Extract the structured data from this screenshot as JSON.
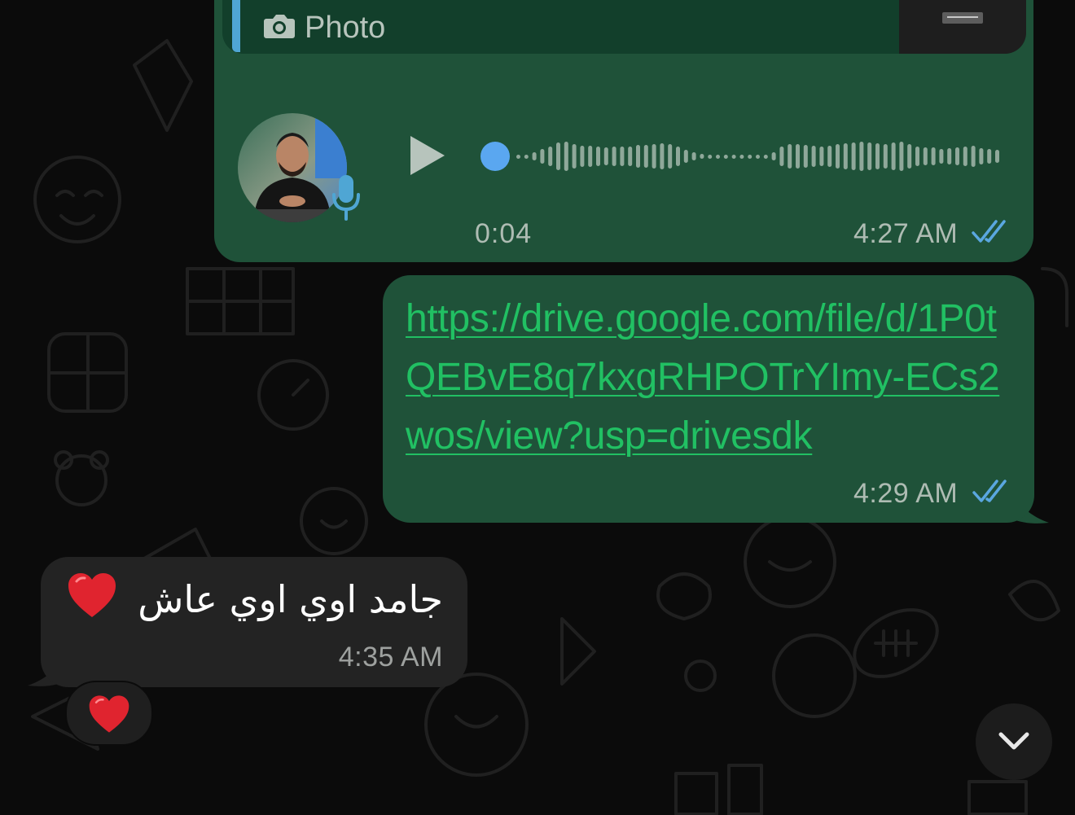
{
  "quoted_message": {
    "label": "Photo",
    "icon": "camera-icon"
  },
  "voice_message": {
    "duration": "0:04",
    "time": "4:27 AM",
    "status": "read",
    "avatar": "contact-avatar",
    "mic_color": "#4fa6d4",
    "progress": 0.0
  },
  "link_message": {
    "text": "https://drive.google.com/file/d/1P0tQEBvE8q7kxgRHPOTrYImy-ECs2wos/view?usp=drivesdk",
    "time": "4:29 AM",
    "status": "read"
  },
  "incoming_message": {
    "text": "جامد اوي اوي عاش",
    "emoji": "red-heart",
    "time": "4:35 AM",
    "reaction": "red-heart"
  },
  "colors": {
    "outgoing_bubble": "#1f5239",
    "incoming_bubble": "#232323",
    "link": "#21c063",
    "read_ticks": "#5aa7e0",
    "background": "#0b0b0b"
  }
}
